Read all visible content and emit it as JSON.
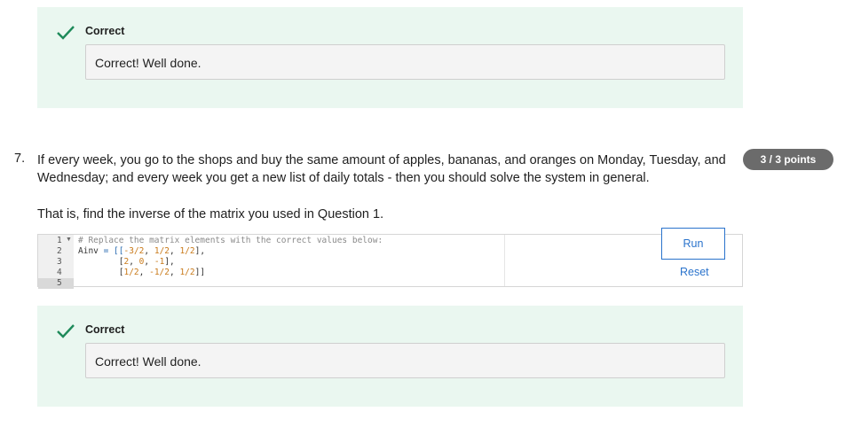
{
  "feedback_top": {
    "status": "Correct",
    "message": "Correct! Well done."
  },
  "question": {
    "number": "7.",
    "text": "If every week, you go to the shops and buy the same amount of apples, bananas, and oranges on Monday, Tuesday, and Wednesday; and every week you get a new list of daily totals - then you should solve the system in general.",
    "instruction": "That is, find the inverse of the matrix you used in Question 1.",
    "points": "3 / 3 points"
  },
  "editor": {
    "line_numbers": [
      "1",
      "2",
      "3",
      "4",
      "5"
    ],
    "code": {
      "comment": "# Replace the matrix elements with the correct values below:",
      "l2": {
        "a": "Ainv",
        "b": " = [[",
        "c": "-3/2",
        "d": ", ",
        "e": "1/2",
        "f": ", ",
        "g": "1/2",
        "h": "],"
      },
      "l3": {
        "a": "        [",
        "b": "2",
        "c": ", ",
        "d": "0",
        "e": ", ",
        "f": "-1",
        "g": "],"
      },
      "l4": {
        "a": "        [",
        "b": "1/2",
        "c": ", ",
        "d": "-1/2",
        "e": ", ",
        "f": "1/2",
        "g": "]]"
      }
    },
    "run_label": "Run",
    "reset_label": "Reset"
  },
  "feedback_bottom": {
    "status": "Correct",
    "message": "Correct! Well done."
  },
  "colors": {
    "success_bg": "#eaf7f0",
    "check": "#1e8a5a",
    "link": "#2a73cc",
    "badge": "#6b6b6b"
  },
  "icons": {
    "check": "check-icon",
    "fold": "fold-arrow-icon"
  }
}
